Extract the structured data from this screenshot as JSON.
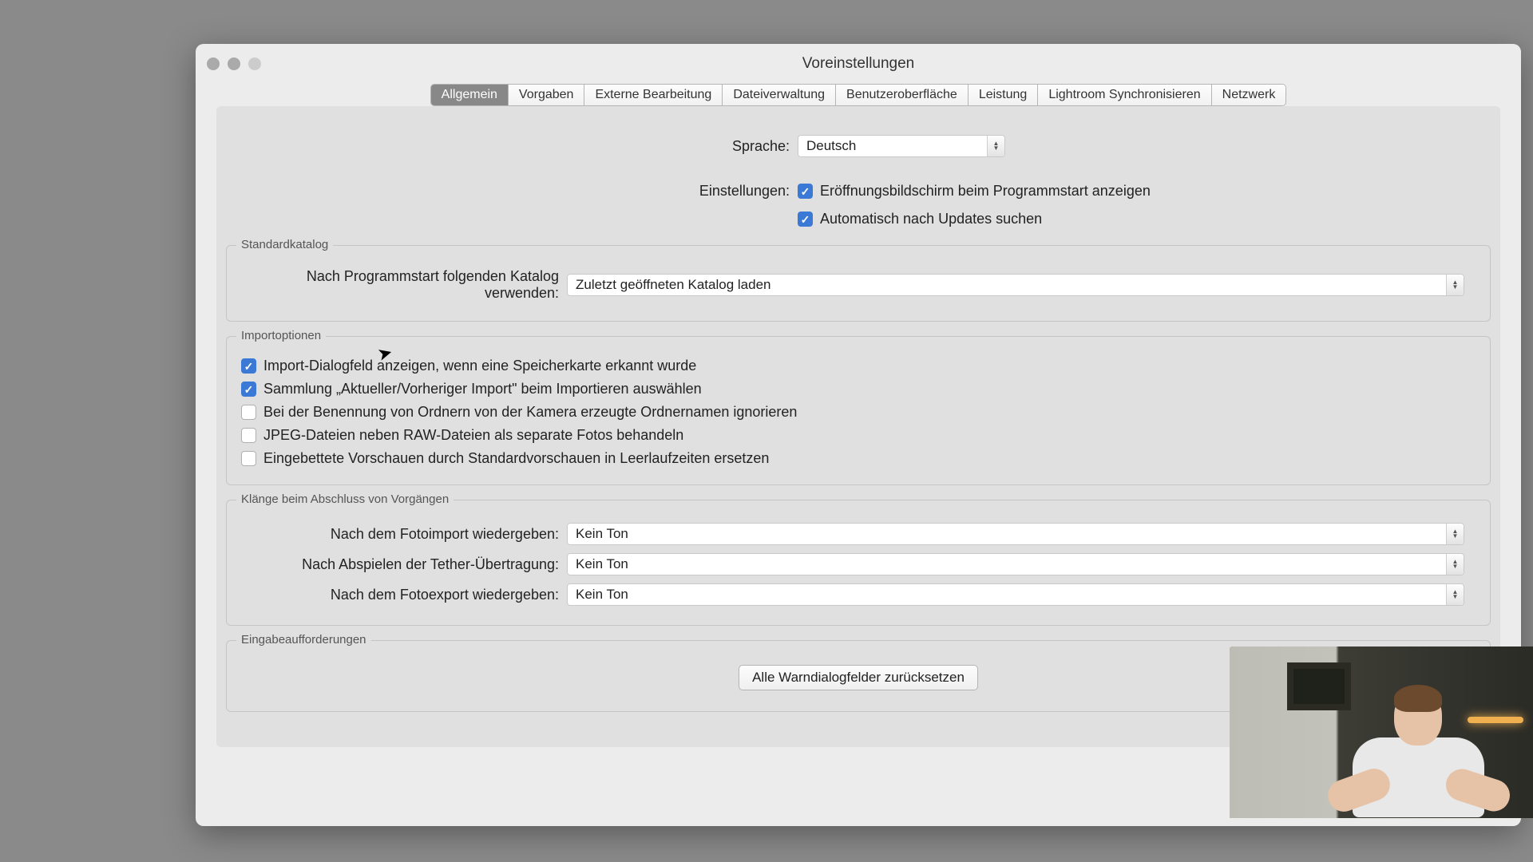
{
  "window": {
    "title": "Voreinstellungen"
  },
  "tabs": [
    "Allgemein",
    "Vorgaben",
    "Externe Bearbeitung",
    "Dateiverwaltung",
    "Benutzeroberfläche",
    "Leistung",
    "Lightroom Synchronisieren",
    "Netzwerk"
  ],
  "top": {
    "language_label": "Sprache:",
    "language_value": "Deutsch",
    "settings_label": "Einstellungen:",
    "splash_label": "Eröffnungsbildschirm beim Programmstart anzeigen",
    "updates_label": "Automatisch nach Updates suchen"
  },
  "catalog": {
    "title": "Standardkatalog",
    "label": "Nach Programmstart folgenden Katalog verwenden:",
    "value": "Zuletzt geöffneten Katalog laden"
  },
  "import": {
    "title": "Importoptionen",
    "opts": [
      "Import-Dialogfeld anzeigen, wenn eine Speicherkarte erkannt wurde",
      "Sammlung „Aktueller/Vorheriger Import\" beim Importieren auswählen",
      "Bei der Benennung von Ordnern von der Kamera erzeugte Ordnernamen ignorieren",
      "JPEG-Dateien neben RAW-Dateien als separate Fotos behandeln",
      "Eingebettete Vorschauen durch Standardvorschauen in Leerlaufzeiten ersetzen"
    ],
    "checked": [
      true,
      true,
      false,
      false,
      false
    ]
  },
  "sounds": {
    "title": "Klänge beim Abschluss von Vorgängen",
    "rows": [
      {
        "label": "Nach dem Fotoimport wiedergeben:",
        "value": "Kein Ton"
      },
      {
        "label": "Nach Abspielen der Tether-Übertragung:",
        "value": "Kein Ton"
      },
      {
        "label": "Nach dem Fotoexport wiedergeben:",
        "value": "Kein Ton"
      }
    ]
  },
  "prompts": {
    "title": "Eingabeaufforderungen",
    "reset_btn": "Alle Warndialogfelder zurücksetzen"
  }
}
